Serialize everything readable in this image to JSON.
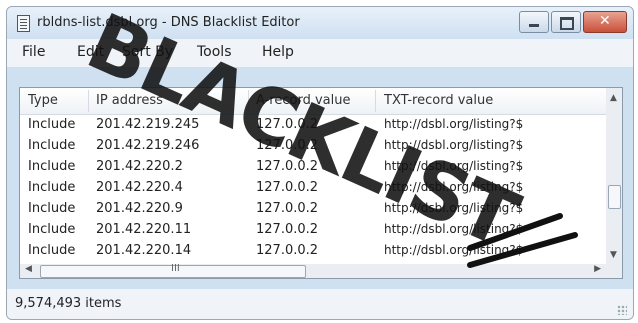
{
  "window": {
    "title": "rbldns-list.dsbl.org - DNS Blacklist Editor",
    "close_glyph": "✕"
  },
  "menu": {
    "items": [
      "File",
      "Edit",
      "Sort By",
      "Tools",
      "Help"
    ]
  },
  "columns": [
    "Type",
    "IP address",
    "A-record value",
    "TXT-record value"
  ],
  "rows": [
    {
      "type": "Include",
      "ip": "201.42.219.245",
      "a": "127.0.0.2",
      "txt": "http://dsbl.org/listing?$"
    },
    {
      "type": "Include",
      "ip": "201.42.219.246",
      "a": "127.0.0.2",
      "txt": "http://dsbl.org/listing?$"
    },
    {
      "type": "Include",
      "ip": "201.42.220.2",
      "a": "127.0.0.2",
      "txt": "http://dsbl.org/listing?$"
    },
    {
      "type": "Include",
      "ip": "201.42.220.4",
      "a": "127.0.0.2",
      "txt": "http://dsbl.org/listing?$"
    },
    {
      "type": "Include",
      "ip": "201.42.220.9",
      "a": "127.0.0.2",
      "txt": "http://dsbl.org/listing?$"
    },
    {
      "type": "Include",
      "ip": "201.42.220.11",
      "a": "127.0.0.2",
      "txt": "http://dsbl.org/listing?$"
    },
    {
      "type": "Include",
      "ip": "201.42.220.14",
      "a": "127.0.0.2",
      "txt": "http://dsbl.org/listing?$"
    }
  ],
  "scrollbar": {
    "grip_glyph": "III"
  },
  "status": {
    "items_count": "9,574,493 items"
  },
  "overlay": {
    "text": "BLACKLIST"
  }
}
